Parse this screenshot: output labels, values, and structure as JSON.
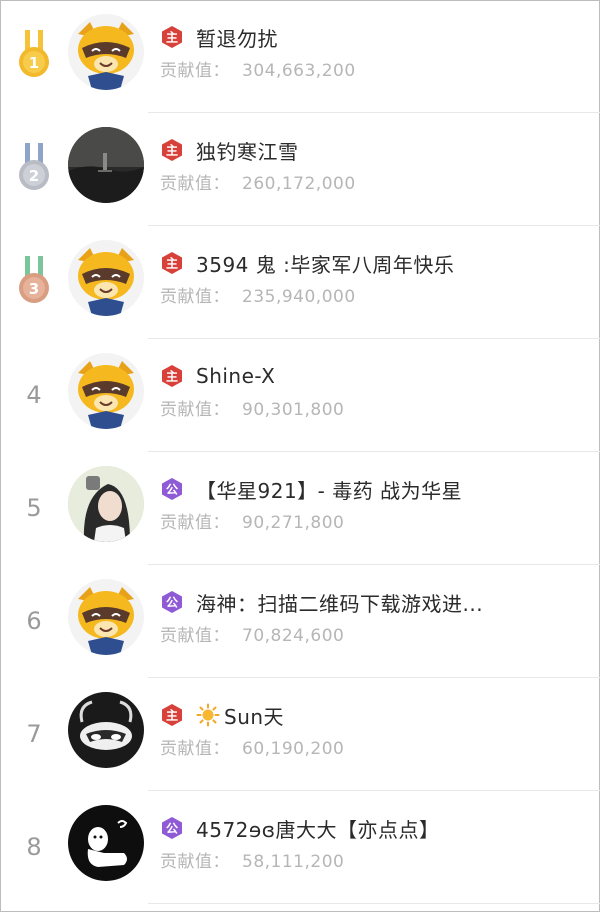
{
  "contribution_label": "贡献值：",
  "colors": {
    "gold": "#f2b92c",
    "silver": "#b9bcc4",
    "bronze": "#d99d82",
    "badge_red": "#d8413a",
    "badge_purple": "#8e5ad6",
    "name_text": "#2b2b2b",
    "muted_text": "#b6b6b6"
  },
  "rows": [
    {
      "rank": "1",
      "rank_style": "gold-medal",
      "avatar": "raccoon-mascot-avatar",
      "badge": "red",
      "badge_char": "主",
      "name": "暂退勿扰",
      "value": "304,663,200"
    },
    {
      "rank": "2",
      "rank_style": "silver-medal",
      "avatar": "dark-landscape-avatar",
      "badge": "red",
      "badge_char": "主",
      "name": "独钓寒江雪",
      "value": "260,172,000"
    },
    {
      "rank": "3",
      "rank_style": "bronze-medal",
      "avatar": "raccoon-mascot-avatar",
      "badge": "red",
      "badge_char": "主",
      "name": "3594 鬼 :毕家军八周年快乐",
      "value": "235,940,000"
    },
    {
      "rank": "4",
      "rank_style": "number",
      "avatar": "raccoon-mascot-avatar",
      "badge": "red",
      "badge_char": "主",
      "name": "Shine-X",
      "value": "90,301,800"
    },
    {
      "rank": "5",
      "rank_style": "number",
      "avatar": "girl-photo-avatar",
      "badge": "purple",
      "badge_char": "公",
      "name": "【华星921】- 毒药 战为华星",
      "value": "90,271,800"
    },
    {
      "rank": "6",
      "rank_style": "number",
      "avatar": "raccoon-mascot-avatar",
      "badge": "purple",
      "badge_char": "公",
      "name": "海神：扫描二维码下载游戏进...",
      "value": "70,824,600"
    },
    {
      "rank": "7",
      "rank_style": "number",
      "avatar": "masked-character-avatar",
      "badge": "red",
      "badge_char": "主",
      "name": "Sun天",
      "value": "60,190,200",
      "name_icon": "sun-icon"
    },
    {
      "rank": "8",
      "rank_style": "number",
      "avatar": "doodle-avatar",
      "badge": "purple",
      "badge_char": "公",
      "name": "4572ɘɞ唐大大【亦点点】",
      "value": "58,111,200"
    }
  ]
}
